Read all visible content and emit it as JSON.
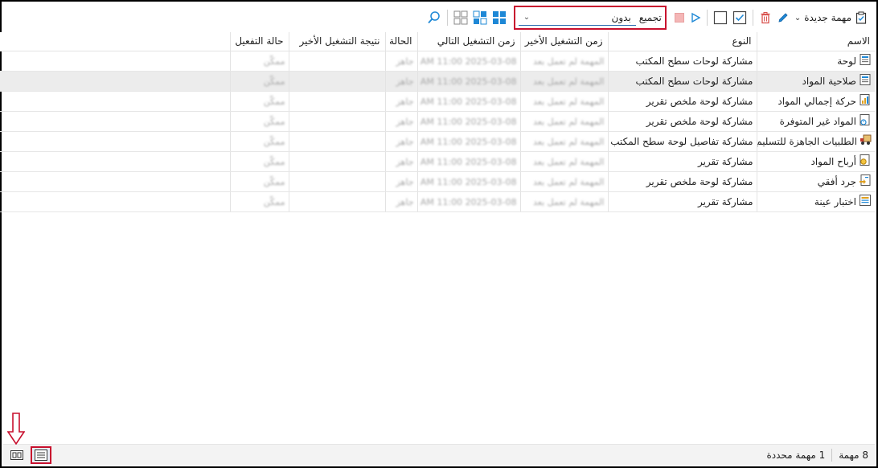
{
  "toolbar": {
    "new_task_label": "مهمة جديدة",
    "group_label": "تجميع",
    "group_value": "بدون"
  },
  "columns": [
    "الاسم",
    "النوع",
    "زمن التشغيل الأخير",
    "زمن التشغيل التالي",
    "الحالة",
    "نتيجة التشغيل الأخير",
    "حالة التفعيل"
  ],
  "rows": [
    {
      "name": "لوحة",
      "type": "مشاركة لوحات سطح المكتب",
      "last_run": "المهمة لم تعمل بعد",
      "next_run": "2025-03-08 11:00 AM",
      "status": "جاهز",
      "result": "",
      "activation": "ممكّن",
      "icon": "dashboard-icon"
    },
    {
      "name": "صلاحية المواد",
      "type": "مشاركة لوحات سطح المكتب",
      "last_run": "المهمة لم تعمل بعد",
      "next_run": "2025-03-08 11:00 AM",
      "status": "جاهز",
      "result": "",
      "activation": "ممكّن",
      "icon": "dashboard-icon"
    },
    {
      "name": "حركة إجمالي المواد",
      "type": "مشاركة لوحة ملخص تقرير",
      "last_run": "المهمة لم تعمل بعد",
      "next_run": "2025-03-08 11:00 AM",
      "status": "جاهز",
      "result": "",
      "activation": "ممكّن",
      "icon": "summary-report-icon"
    },
    {
      "name": "المواد غير المتوفرة",
      "type": "مشاركة لوحة ملخص تقرير",
      "last_run": "المهمة لم تعمل بعد",
      "next_run": "2025-03-08 11:00 AM",
      "status": "جاهز",
      "result": "",
      "activation": "ممكّن",
      "icon": "unavailable-items-icon"
    },
    {
      "name": "الطلبيات الجاهزة للتسليم",
      "type": "مشاركة تفاصيل لوحة سطح المكتب",
      "last_run": "المهمة لم تعمل بعد",
      "next_run": "2025-03-08 11:00 AM",
      "status": "جاهز",
      "result": "",
      "activation": "ممكّن",
      "icon": "delivery-truck-icon"
    },
    {
      "name": "أرباح المواد",
      "type": "مشاركة تقرير",
      "last_run": "المهمة لم تعمل بعد",
      "next_run": "2025-03-08 11:00 AM",
      "status": "جاهز",
      "result": "",
      "activation": "ممكّن",
      "icon": "profit-report-icon"
    },
    {
      "name": "جرد أفقي",
      "type": "مشاركة لوحة ملخص تقرير",
      "last_run": "المهمة لم تعمل بعد",
      "next_run": "2025-03-08 11:00 AM",
      "status": "جاهز",
      "result": "",
      "activation": "ممكّن",
      "icon": "inventory-report-icon"
    },
    {
      "name": "اختبار عينة",
      "type": "مشاركة تقرير",
      "last_run": "المهمة لم تعمل بعد",
      "next_run": "2025-03-08 11:00 AM",
      "status": "جاهز",
      "result": "",
      "activation": "ممكّن",
      "icon": "sample-report-icon"
    }
  ],
  "status": {
    "count": "8 مهمة",
    "selected": "1 مهمة محددة"
  },
  "colors": {
    "accent": "#1e88d6",
    "highlight": "#c8102e",
    "selected_row": "#ececec",
    "delete": "#d9534f"
  }
}
